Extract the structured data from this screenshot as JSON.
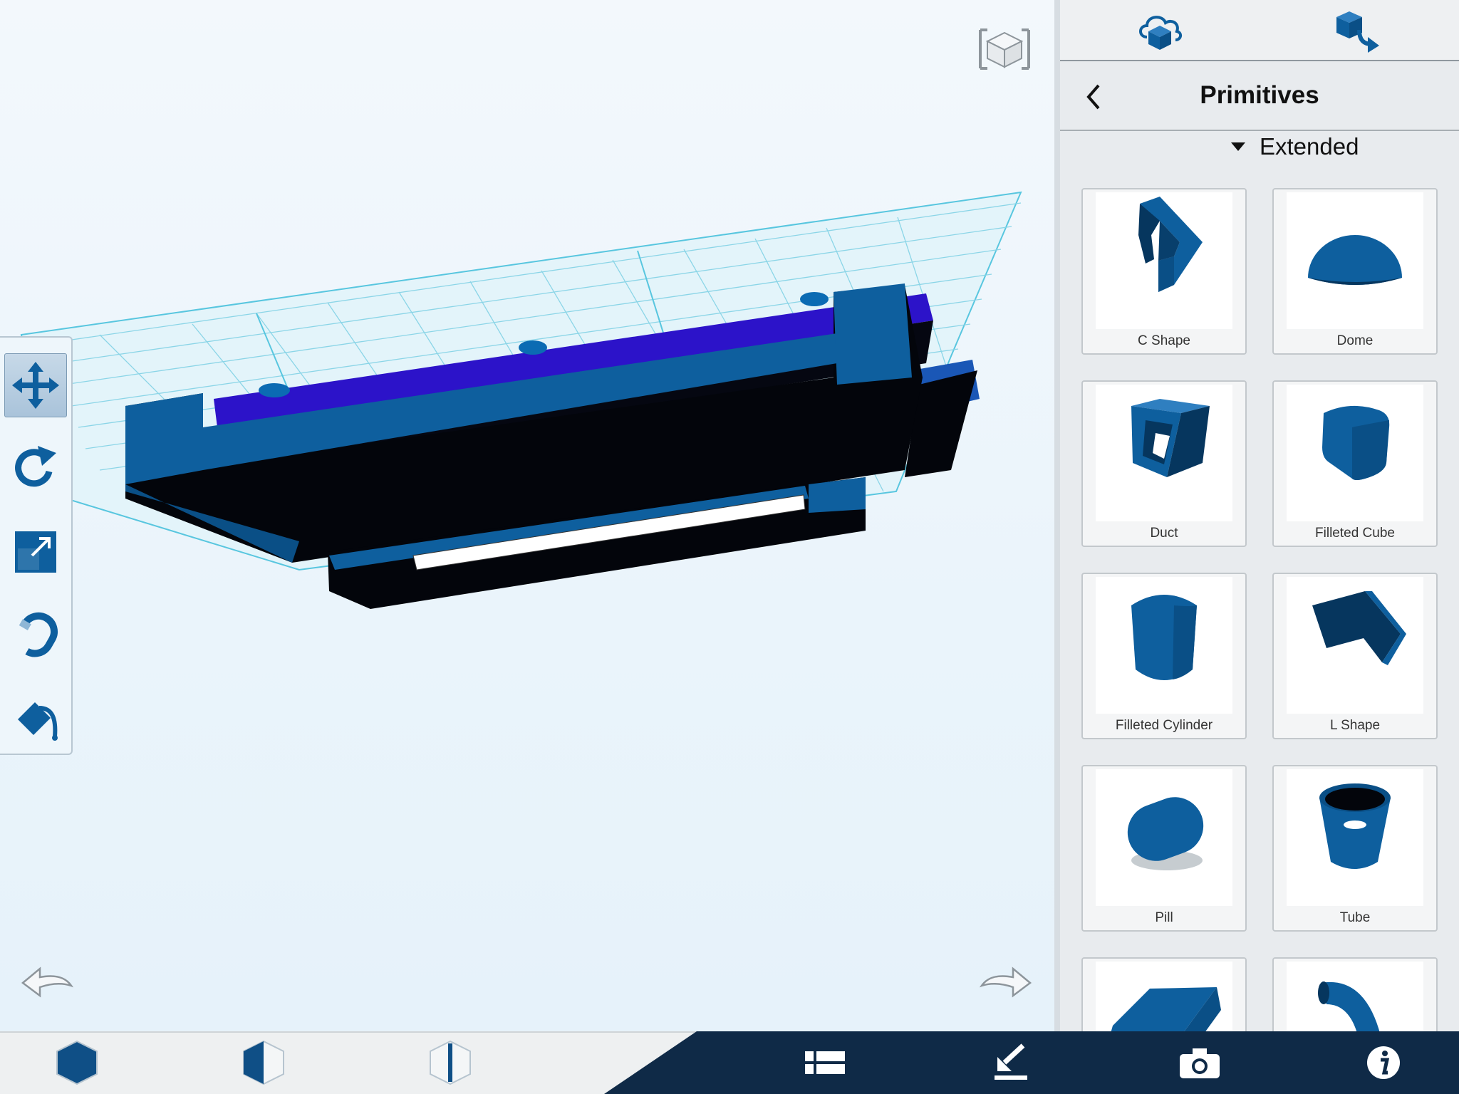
{
  "colors": {
    "accent": "#0e5f9e",
    "object_dark": "#03050b",
    "object_purple": "#2c13c9",
    "grid": "#58c6df",
    "bottom_bar_dark": "#0f2a47"
  },
  "viewport": {
    "view_cube_icon": "view-cube-icon",
    "undo_icon": "undo-arrow-icon",
    "redo_icon": "redo-arrow-icon"
  },
  "toolbar": {
    "tools": [
      {
        "name": "move",
        "icon": "move-arrows-icon",
        "active": true
      },
      {
        "name": "rotate",
        "icon": "rotate-icon",
        "active": false
      },
      {
        "name": "scale",
        "icon": "scale-icon",
        "active": false
      },
      {
        "name": "snap",
        "icon": "magnet-icon",
        "active": false
      },
      {
        "name": "material",
        "icon": "paint-bucket-icon",
        "active": false
      }
    ]
  },
  "panel": {
    "top_icons": [
      "cloud-upload-icon",
      "import-model-icon"
    ],
    "title": "Primitives",
    "section": "Extended",
    "items": [
      {
        "label": "C Shape"
      },
      {
        "label": "Dome"
      },
      {
        "label": "Duct"
      },
      {
        "label": "Filleted Cube"
      },
      {
        "label": "Filleted Cylinder"
      },
      {
        "label": "L Shape"
      },
      {
        "label": "Pill"
      },
      {
        "label": "Tube"
      },
      {
        "label": ""
      },
      {
        "label": ""
      }
    ]
  },
  "bottom_bar": {
    "view_modes": [
      "solid-view-icon",
      "half-transparent-view-icon",
      "wireframe-view-icon"
    ],
    "actions": [
      "list-icon",
      "download-icon",
      "camera-icon",
      "info-icon"
    ]
  }
}
